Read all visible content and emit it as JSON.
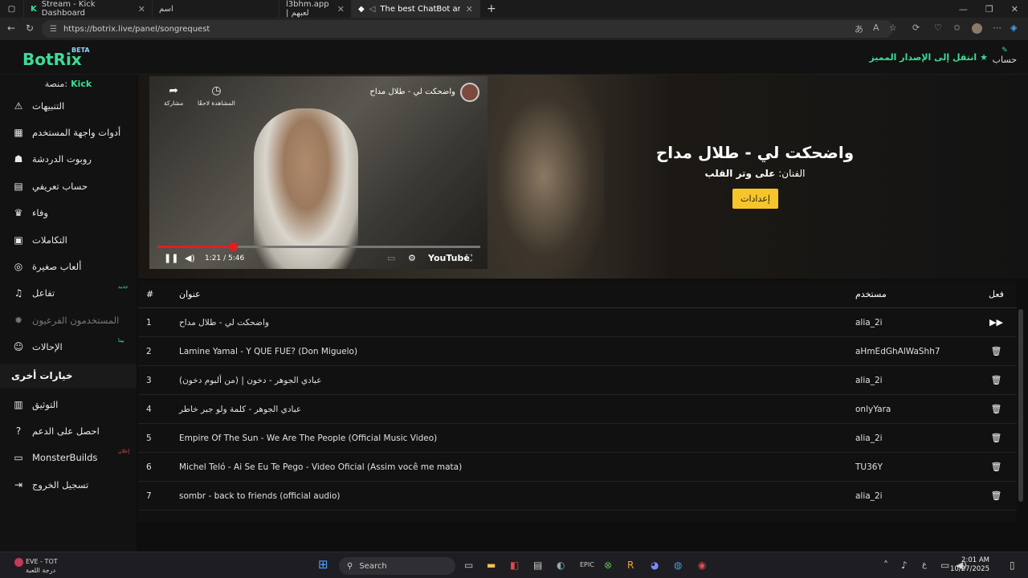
{
  "browser": {
    "tabs": [
      {
        "title": "Stream - Kick Dashboard",
        "active": false
      },
      {
        "title": "اسم",
        "active": false
      },
      {
        "title": "l3bhm.app | لعبهم",
        "active": false
      },
      {
        "title": "The best ChatBot and Widge",
        "active": true
      }
    ],
    "new_tab": "+",
    "url": "https://botrix.live/panel/songrequest"
  },
  "app": {
    "logo": "BotRix",
    "beta": "BETA",
    "premium": "انتقل إلى الإصدار المميز",
    "account": "حساب",
    "platform_label": "منصة:",
    "platform_value": "Kick"
  },
  "sidebar": {
    "items": [
      {
        "label": "التنبيهات",
        "icon": "warning-icon",
        "glyph": "⚠",
        "tag": ""
      },
      {
        "label": "أدوات واجهة المستخدم",
        "icon": "grid-icon",
        "glyph": "▦",
        "tag": ""
      },
      {
        "label": "روبوت الدردشة",
        "icon": "robot-icon",
        "glyph": "☗",
        "tag": ""
      },
      {
        "label": "حساب تعريفي",
        "icon": "id-card-icon",
        "glyph": "▤",
        "tag": ""
      },
      {
        "label": "وفاء",
        "icon": "trophy-icon",
        "glyph": "♛",
        "tag": ""
      },
      {
        "label": "التكاملات",
        "icon": "plug-icon",
        "glyph": "▣",
        "tag": ""
      },
      {
        "label": "ألعاب صغيرة",
        "icon": "gamepad-icon",
        "glyph": "◎",
        "tag": ""
      },
      {
        "label": "تفاعل",
        "icon": "music-icon",
        "glyph": "♫",
        "tag": "جديد"
      },
      {
        "label": "المستخدمون الفرعيون",
        "icon": "users-icon",
        "glyph": "✹",
        "tag": "",
        "dim": true
      },
      {
        "label": "الإحالات",
        "icon": "referral-icon",
        "glyph": "☺",
        "tag": "بيتا"
      }
    ],
    "other_section": "خيارات أخرى",
    "other_items": [
      {
        "label": "التوثيق",
        "icon": "book-icon",
        "glyph": "▥",
        "tag": ""
      },
      {
        "label": "احصل على الدعم",
        "icon": "help-icon",
        "glyph": "?",
        "tag": ""
      },
      {
        "label": "MonsterBuilds",
        "icon": "monitor-icon",
        "glyph": "▭",
        "tag": "إعلان"
      },
      {
        "label": "تسجيل الخروج",
        "icon": "logout-icon",
        "glyph": "⇥",
        "tag": ""
      }
    ]
  },
  "player": {
    "video_title": "واضحكت لي - طلال مداح",
    "share_label": "مشاركة",
    "watch_later_label": "المشاهدة لاحقًا",
    "time": "1:21 / 5:46",
    "progress": 0.234,
    "brand": "YouTube"
  },
  "now_playing": {
    "song": "واضحكت لي - طلال مداح",
    "artist_label": "الفنان:",
    "artist": "على وتر القلب",
    "settings_button": "إعدادات"
  },
  "queue": {
    "headers": {
      "num": "#",
      "title": "عنوان",
      "user": "مستخدم",
      "action": "فعل"
    },
    "rows": [
      {
        "num": "1",
        "title": "واضحكت لي - طلال مداح",
        "user": "alia_2i",
        "action": "play"
      },
      {
        "num": "2",
        "title": "Lamine Yamal - Y QUE FUE? (Don Miguelo)",
        "user": "aHmEdGhAlWaShh7",
        "action": "delete"
      },
      {
        "num": "3",
        "title": "عبادي الجوهر - دخون | (من ألبوم دخون)",
        "user": "alia_2i",
        "action": "delete"
      },
      {
        "num": "4",
        "title": "عبادي الجوهر - كلمة ولو جبر خاطر",
        "user": "onlyYara",
        "action": "delete"
      },
      {
        "num": "5",
        "title": "Empire Of The Sun - We Are The People (Official Music Video)",
        "user": "alia_2i",
        "action": "delete"
      },
      {
        "num": "6",
        "title": "Michel Teló - Ai Se Eu Te Pego - Video Oficial (Assim você me mata)",
        "user": "TU36Y",
        "action": "delete"
      },
      {
        "num": "7",
        "title": "sombr - back to friends (official audio)",
        "user": "alia_2i",
        "action": "delete"
      }
    ]
  },
  "taskbar": {
    "eve_title": "EVE - TOT",
    "eve_sub": "درجة اللعبة",
    "search": "Search",
    "time": "2:01 AM",
    "date": "10/27/2025",
    "lang": "ع"
  }
}
